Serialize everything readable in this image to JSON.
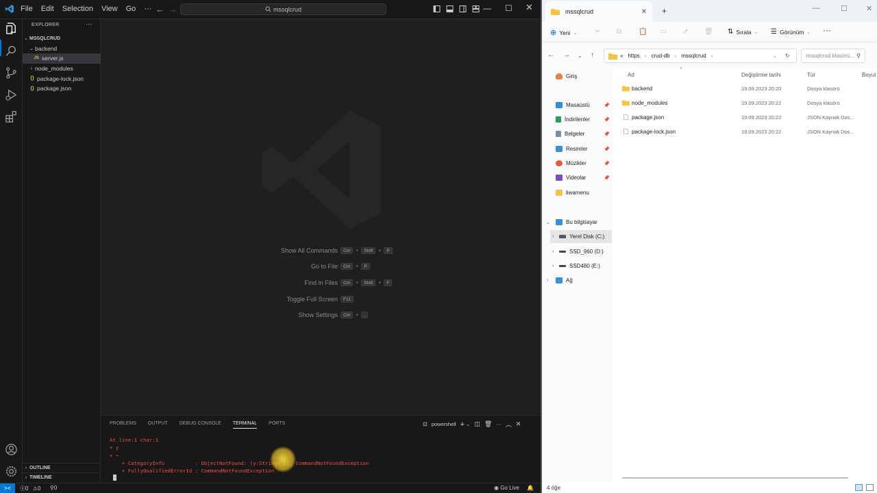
{
  "vscode": {
    "menu": [
      "File",
      "Edit",
      "Selection",
      "View",
      "Go",
      "···"
    ],
    "command_center": "mssqlcrud",
    "explorer_title": "EXPLORER",
    "explorer_more": "···",
    "tree": [
      {
        "label": "MSSQLCRUD",
        "kind": "root"
      },
      {
        "label": "backend",
        "kind": "folder-open"
      },
      {
        "label": "server.js",
        "kind": "js",
        "badge": "JS"
      },
      {
        "label": "node_modules",
        "kind": "folder-closed"
      },
      {
        "label": "package-lock.json",
        "kind": "json",
        "badge": "{}"
      },
      {
        "label": "package.json",
        "kind": "json",
        "badge": "{}"
      }
    ],
    "outline": "OUTLINE",
    "timeline": "TIMELINE",
    "shortcuts": [
      {
        "label": "Show All Commands",
        "keys": [
          "Ctrl",
          "Shift",
          "P"
        ]
      },
      {
        "label": "Go to File",
        "keys": [
          "Ctrl",
          "P"
        ]
      },
      {
        "label": "Find in Files",
        "keys": [
          "Ctrl",
          "Shift",
          "F"
        ]
      },
      {
        "label": "Toggle Full Screen",
        "keys": [
          "F11"
        ]
      },
      {
        "label": "Show Settings",
        "keys": [
          "Ctrl",
          ","
        ]
      }
    ],
    "panel_tabs": [
      "PROBLEMS",
      "OUTPUT",
      "DEBUG CONSOLE",
      "TERMINAL",
      "PORTS"
    ],
    "active_panel_tab": "TERMINAL",
    "terminal_shell": "powershell",
    "terminal_lines": [
      "At line:1 char:1",
      "+ y",
      "+ ~",
      "    + CategoryInfo          : ObjectNotFound: (y:String) [], CommandNotFoundException",
      "    + FullyQualifiedErrorId : CommandNotFoundException"
    ],
    "status": {
      "remote": "><",
      "errors": "0",
      "warnings": "0",
      "ports": "0",
      "go_live": "Go Live"
    },
    "accent": "#0078d4",
    "error_color": "#f14c4c"
  },
  "file_explorer": {
    "tab_title": "mssqlcrud",
    "new_label": "Yeni",
    "sort_label": "Sırala",
    "view_label": "Görünüm",
    "more_label": "···",
    "path": [
      "«",
      "https",
      "crud-db",
      "mssqlcrud"
    ],
    "search_placeholder": "mssqlcrud klasörü...",
    "nav": {
      "home": "Giriş",
      "quick": [
        {
          "label": "Masaüstü",
          "icon": "desktop-icon",
          "color": "#2d8fd5"
        },
        {
          "label": "İndirilenler",
          "icon": "download-icon",
          "color": "#2a9d5c"
        },
        {
          "label": "Belgeler",
          "icon": "documents-icon",
          "color": "#7a8ca8"
        },
        {
          "label": "Resimler",
          "icon": "pictures-icon",
          "color": "#3c8fd0"
        },
        {
          "label": "Müzikler",
          "icon": "music-icon",
          "color": "#e05a3b"
        },
        {
          "label": "Videolar",
          "icon": "videos-icon",
          "color": "#7c4fc4"
        },
        {
          "label": "liwamenu",
          "icon": "folder-icon",
          "color": "#f2c14e"
        }
      ],
      "this_pc": "Bu bilgisayar",
      "drives": [
        "Yerel Disk (C:)",
        "SSD_960 (D:)",
        "SSD480 (E:)"
      ],
      "network": "Ağ"
    },
    "columns": [
      "Ad",
      "Değiştirme tarihi",
      "Tür",
      "Boyut"
    ],
    "files": [
      {
        "name": "backend",
        "date": "19.09.2023 20:20",
        "type": "Dosya klasörü",
        "icon": "folder-icon"
      },
      {
        "name": "node_modules",
        "date": "19.09.2023 20:22",
        "type": "Dosya klasörü",
        "icon": "folder-icon"
      },
      {
        "name": "package.json",
        "date": "19.09.2023 20:22",
        "type": "JSON Kaynak Dos...",
        "icon": "file-icon"
      },
      {
        "name": "package-lock.json",
        "date": "19.09.2023 20:22",
        "type": "JSON Kaynak Dos...",
        "icon": "file-icon"
      }
    ],
    "item_count": "4 öğe"
  }
}
